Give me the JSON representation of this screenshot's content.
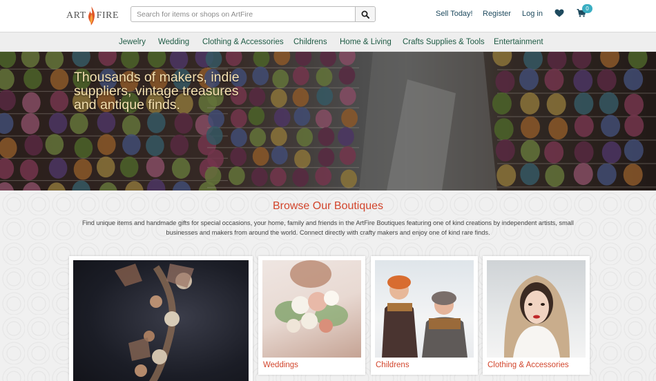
{
  "header": {
    "logo_left": "ART",
    "logo_right": "FIRE",
    "search_placeholder": "Search for items or shops on ArtFire",
    "links": [
      "Sell Today!",
      "Register",
      "Log in"
    ],
    "cart_count": "0"
  },
  "nav": {
    "items": [
      "Jewelry",
      "Wedding",
      "Clothing & Accessories",
      "Childrens",
      "Home & Living",
      "Crafts Supplies & Tools",
      "Entertainment"
    ]
  },
  "hero": {
    "headline": "Thousands of makers, indie suppliers, vintage treasures and antique finds."
  },
  "browse": {
    "title": "Browse Our Boutiques",
    "description": "Find unique items and handmade gifts for special occasions, your home, family and friends in the ArtFire Boutiques featuring one of kind creations by independent artists, small businesses and makers from around the world. Connect directly with crafty makers and enjoy one of kind rare finds.",
    "cards": [
      {
        "label": ""
      },
      {
        "label": "Weddings"
      },
      {
        "label": "Childrens"
      },
      {
        "label": "Clothing & Accessories"
      }
    ]
  },
  "colors": {
    "accent": "#d2452c",
    "nav_text": "#1e5a44",
    "header_link": "#1e4a5e",
    "badge": "#3aaec2",
    "hero_text": "#f4e0b0"
  },
  "icons": [
    "search-icon",
    "heart-icon",
    "cart-icon",
    "flame-icon"
  ]
}
